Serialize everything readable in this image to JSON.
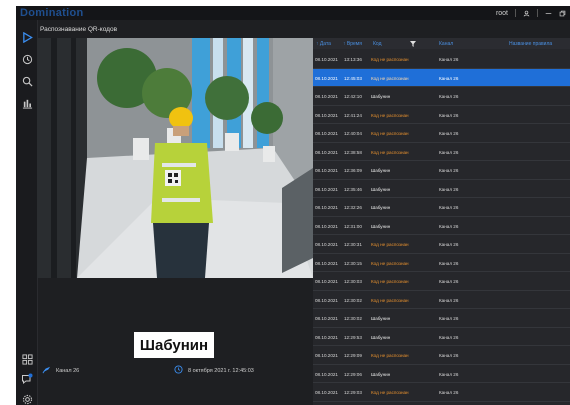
{
  "app": {
    "brand": "Domination",
    "page_title": "Распознавание QR-кодов"
  },
  "titlebar": {
    "user": "root"
  },
  "table": {
    "headers": {
      "date": "↑ Дата",
      "time": "↑ Время",
      "code": "Код",
      "channel": "Канал",
      "note": "Название правила"
    },
    "rows": [
      {
        "date": "08.10.2021",
        "time": "13:13:36",
        "code": "Код не распознан",
        "channel": "Канал 26",
        "status": "warn"
      },
      {
        "date": "08.10.2021",
        "time": "12:45:03",
        "code": "Код не распознан",
        "channel": "Канал 26",
        "status": "warn",
        "selected": true
      },
      {
        "date": "08.10.2021",
        "time": "12:42:10",
        "code": "Шабунин",
        "channel": "Канал 26",
        "status": "ok"
      },
      {
        "date": "08.10.2021",
        "time": "12:41:24",
        "code": "Код не распознан",
        "channel": "Канал 26",
        "status": "warn"
      },
      {
        "date": "08.10.2021",
        "time": "12:40:04",
        "code": "Код не распознан",
        "channel": "Канал 26",
        "status": "warn"
      },
      {
        "date": "08.10.2021",
        "time": "12:38:58",
        "code": "Код не распознан",
        "channel": "Канал 26",
        "status": "warn"
      },
      {
        "date": "08.10.2021",
        "time": "12:36:09",
        "code": "Шабунин",
        "channel": "Канал 26",
        "status": "ok"
      },
      {
        "date": "08.10.2021",
        "time": "12:35:46",
        "code": "Шабунин",
        "channel": "Канал 26",
        "status": "ok"
      },
      {
        "date": "08.10.2021",
        "time": "12:32:26",
        "code": "Шабунин",
        "channel": "Канал 26",
        "status": "ok"
      },
      {
        "date": "08.10.2021",
        "time": "12:31:00",
        "code": "Шабунин",
        "channel": "Канал 26",
        "status": "ok"
      },
      {
        "date": "08.10.2021",
        "time": "12:30:31",
        "code": "Код не распознан",
        "channel": "Канал 26",
        "status": "warn"
      },
      {
        "date": "08.10.2021",
        "time": "12:30:15",
        "code": "Код не распознан",
        "channel": "Канал 26",
        "status": "warn"
      },
      {
        "date": "08.10.2021",
        "time": "12:30:03",
        "code": "Код не распознан",
        "channel": "Канал 26",
        "status": "warn"
      },
      {
        "date": "08.10.2021",
        "time": "12:30:02",
        "code": "Код не распознан",
        "channel": "Канал 26",
        "status": "warn"
      },
      {
        "date": "08.10.2021",
        "time": "12:30:02",
        "code": "Шабунин",
        "channel": "Канал 26",
        "status": "ok"
      },
      {
        "date": "08.10.2021",
        "time": "12:29:53",
        "code": "Шабунин",
        "channel": "Канал 26",
        "status": "ok"
      },
      {
        "date": "08.10.2021",
        "time": "12:29:09",
        "code": "Код не распознан",
        "channel": "Канал 26",
        "status": "warn"
      },
      {
        "date": "08.10.2021",
        "time": "12:29:06",
        "code": "Шабунин",
        "channel": "Канал 26",
        "status": "ok"
      },
      {
        "date": "08.10.2021",
        "time": "12:29:03",
        "code": "Код не распознан",
        "channel": "Канал 26",
        "status": "warn"
      }
    ]
  },
  "video": {
    "person_label": "Шабунин",
    "channel": "Канал 26",
    "timestamp": "8 октября 2021 г. 12:45:03"
  },
  "colors": {
    "accent": "#1f6fd8",
    "warn": "#e6902e",
    "bg": "#1e1f22"
  },
  "icons": {
    "sidebar": [
      "play-icon",
      "history-icon",
      "search-icon",
      "chart-icon",
      "layout-icon",
      "notifications-icon",
      "settings-icon"
    ]
  }
}
